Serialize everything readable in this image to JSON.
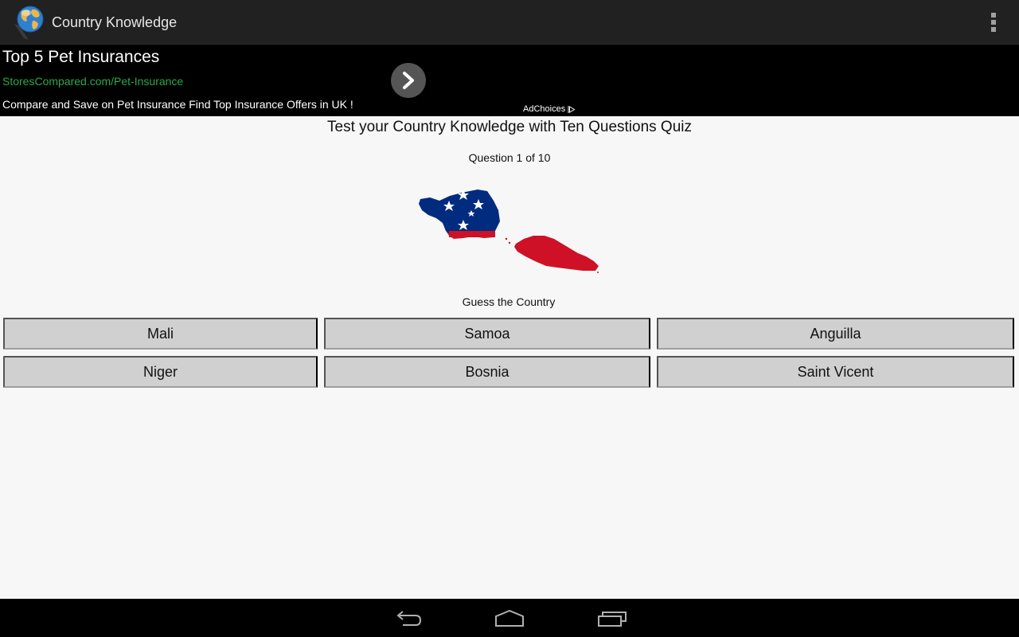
{
  "action_bar": {
    "title": "Country Knowledge",
    "app_icon": "globe-icon",
    "overflow_icon": "overflow-menu-icon"
  },
  "ad": {
    "title": "Top 5 Pet Insurances",
    "url": "StoresCompared.com/Pet-Insurance",
    "description": "Compare and Save on Pet Insurance Find Top Insurance Offers in UK !",
    "adchoices_label": "AdChoices",
    "arrow_icon": "chevron-right-icon",
    "colors": {
      "url": "#2ba84a",
      "background": "#000000"
    }
  },
  "quiz": {
    "title": "Test your Country Knowledge with Ten Questions Quiz",
    "question_counter": "Question 1 of 10",
    "current_question": 1,
    "total_questions": 10,
    "image": "samoa-map-flag",
    "prompt": "Guess the Country",
    "answers": [
      {
        "label": "Mali"
      },
      {
        "label": "Samoa"
      },
      {
        "label": "Anguilla"
      },
      {
        "label": "Niger"
      },
      {
        "label": "Bosnia"
      },
      {
        "label": "Saint Vicent"
      }
    ]
  },
  "nav_bar": {
    "buttons": [
      "back-icon",
      "home-icon",
      "recent-apps-icon"
    ]
  }
}
